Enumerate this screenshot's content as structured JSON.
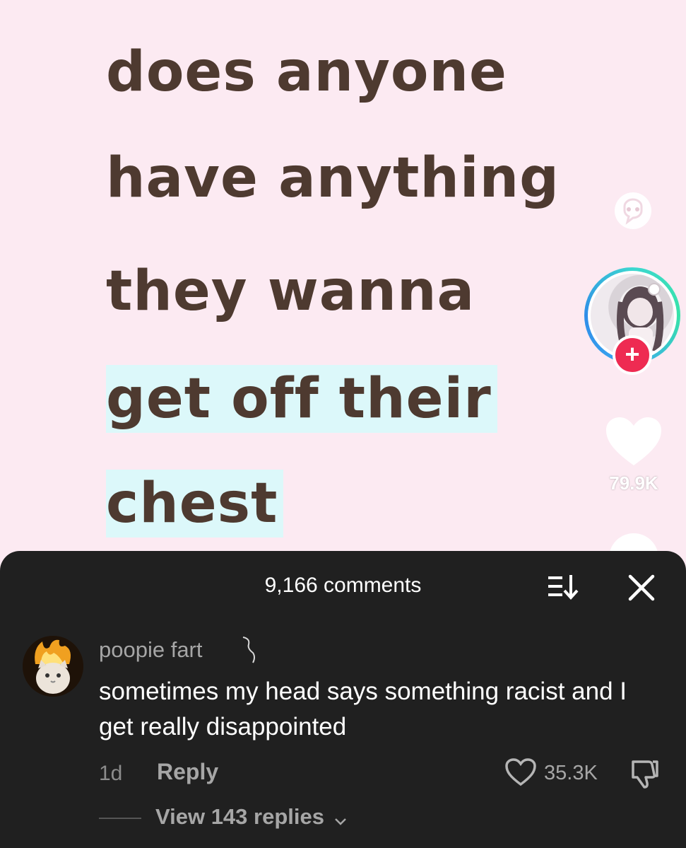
{
  "video": {
    "caption_lines": [
      "does anyone",
      "have anything",
      "they wanna",
      "get off their",
      "chest"
    ],
    "highlight_color": "#dcf8fa",
    "text_color": "#4e3a30",
    "background": "#fceaf2"
  },
  "rail": {
    "icons": {
      "bubble": "chat-bubble-icon",
      "follow": "plus-icon",
      "like": "heart-icon"
    },
    "follow_symbol": "+",
    "like_count": "79.9K",
    "follow_color": "#ee2b52"
  },
  "comments_sheet": {
    "title": "9,166 comments",
    "icons": {
      "sort": "sort-icon",
      "close": "close-icon"
    },
    "comment": {
      "username": "poopie fart",
      "text": "sometimes my head says something racist and I get really disappointed",
      "age": "1d",
      "reply_label": "Reply",
      "like_count": "35.3K",
      "view_replies_label": "View 143 replies"
    },
    "background": "#202020"
  }
}
